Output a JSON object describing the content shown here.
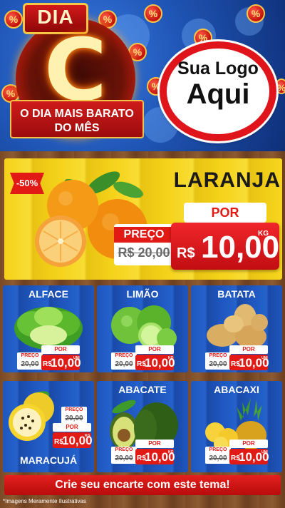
{
  "header": {
    "badge_top": "DIA",
    "badge_letter": "C",
    "ribbon_line1": "O DIA MAIS BARATO",
    "ribbon_line2": "DO MÊS",
    "coin_symbol": "%",
    "logo_line1": "Sua Logo",
    "logo_line2": "Aqui"
  },
  "hero": {
    "discount": "-50%",
    "name": "LARANJA",
    "preco_label": "PREÇO",
    "old_price": "R$ 20,00",
    "por_label": "POR",
    "currency": "R$",
    "price": "10,00",
    "unit": "KG"
  },
  "products": [
    {
      "name": "ALFACE",
      "preco_label": "PREÇO",
      "old_price": "20,00",
      "por_label": "POR",
      "currency": "R$",
      "price": "10,00",
      "unit": "UNI"
    },
    {
      "name": "LIMÃO",
      "preco_label": "PREÇO",
      "old_price": "20,00",
      "por_label": "POR",
      "currency": "R$",
      "price": "10,00",
      "unit": "KG"
    },
    {
      "name": "BATATA",
      "preco_label": "PREÇO",
      "old_price": "20,00",
      "por_label": "POR",
      "currency": "R$",
      "price": "10,00",
      "unit": "UNI"
    },
    {
      "name": "MARACUJÁ",
      "preco_label": "PREÇO",
      "old_price": "20,00",
      "por_label": "POR",
      "currency": "R$",
      "price": "10,00",
      "unit": "KG"
    },
    {
      "name": "ABACATE",
      "preco_label": "PREÇO",
      "old_price": "20,00",
      "por_label": "POR",
      "currency": "R$",
      "price": "10,00",
      "unit": "KG"
    },
    {
      "name": "ABACAXI",
      "preco_label": "PREÇO",
      "old_price": "20,00",
      "por_label": "POR",
      "currency": "R$",
      "price": "10,00",
      "unit": "UNI"
    }
  ],
  "footer": {
    "cta": "Crie seu encarte com este tema!",
    "disclaimer": "*Imagens Meramente Ilustrativas"
  },
  "colors": {
    "accent_red": "#e21a16",
    "hero_yellow": "#f5d21a",
    "card_blue": "#1f56bf",
    "header_blue": "#1f55b5"
  }
}
